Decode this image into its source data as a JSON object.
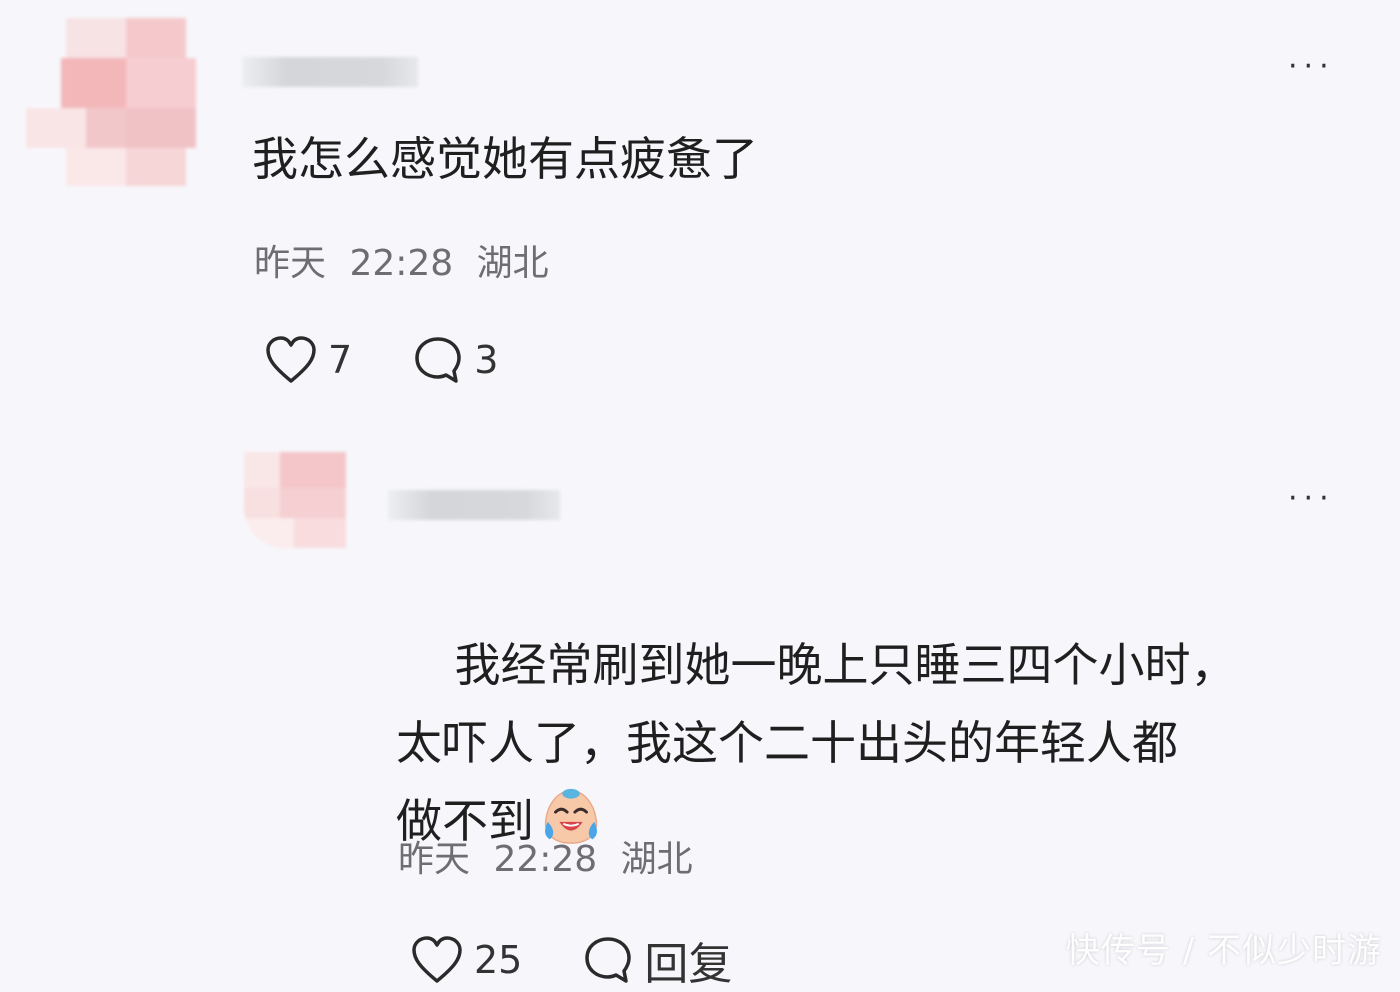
{
  "comments": [
    {
      "body": "我怎么感觉她有点疲惫了",
      "date": "昨天",
      "time": "22:28",
      "location": "湖北",
      "like_count": "7",
      "reply_count": "3",
      "more_label": "···"
    },
    {
      "body": "我经常刷到她一晚上只睡三四个小时，\n太吓人了，我这个二十出头的年轻人都\n做不到",
      "emoji": "crying-laughing-emoji",
      "date": "昨天",
      "time": "22:28",
      "location": "湖北",
      "like_count": "25",
      "reply_label": "回复",
      "more_label": "···"
    }
  ],
  "watermark": "快传号 / 不似少时游",
  "colors": {
    "background": "#f7f7fb",
    "avatar_pink": "#f3b7ba",
    "meta_text": "#6e6e72"
  },
  "icons": [
    "heart-outline-icon",
    "comment-bubble-icon",
    "more-dots-icon"
  ]
}
